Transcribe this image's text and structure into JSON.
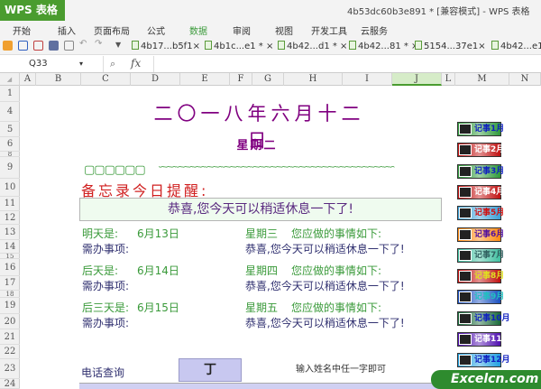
{
  "app": {
    "name": "WPS 表格",
    "window_title": "4b53dc60b3e891 * [兼容模式] - WPS 表格"
  },
  "menu": [
    "开始",
    "插入",
    "页面布局",
    "公式",
    "数据",
    "审阅",
    "视图",
    "开发工具",
    "云服务"
  ],
  "active_menu": "数据",
  "doc_tabs": [
    "4b17...b5f1×",
    "4b1c...e1 * ×",
    "4b42...d1 * ×",
    "4b42...81 * ×",
    "5154...37e1×",
    "4b42...e1"
  ],
  "formula_bar": {
    "name_box": "Q33",
    "fx": "fx",
    "value": ""
  },
  "columns": [
    "A",
    "B",
    "C",
    "D",
    "E",
    "F",
    "G",
    "H",
    "I",
    "J",
    "L",
    "M",
    "N"
  ],
  "rows": [
    "1",
    "4",
    "5",
    "6",
    "8",
    "9",
    "10",
    "11",
    "12",
    "13",
    "14",
    "15",
    "16",
    "17",
    "18",
    "19",
    "20",
    "21",
    "22",
    "23",
    "24"
  ],
  "sheet": {
    "date": "二〇一八年六月十二日",
    "weekday": "星期二",
    "deco_boxes": "▢▢▢▢▢▢",
    "deco_wave": "∽∽∽∽∽∽∽∽∽∽∽∽∽∽∽∽∽∽∽∽∽∽∽∽∽∽∽∽∽∽∽∽∽∽∽∽∽∽∽∽∽",
    "memo_title": "备忘录今日提醒:",
    "memo_text": "恭喜,您今天可以稍适休息一下了!",
    "days": [
      {
        "label": "明天是:",
        "date": "6月13日",
        "weekday": "星期三",
        "todo_head": "您应做的事情如下:",
        "todo_label": "需办事项:",
        "todo": "恭喜,您今天可以稍适休息一下了!"
      },
      {
        "label": "后天是:",
        "date": "6月14日",
        "weekday": "星期四",
        "todo_head": "您应做的事情如下:",
        "todo_label": "需办事项:",
        "todo": "恭喜,您今天可以稍适休息一下了!"
      },
      {
        "label": "后三天是:",
        "date": "6月15日",
        "weekday": "星期五",
        "todo_head": "您应做的事情如下:",
        "todo_label": "需办事项:",
        "todo": "恭喜,您今天可以稍适休息一下了!"
      }
    ],
    "phone_label": "电话查询",
    "phone_input": "丁",
    "phone_hint": "输入姓名中任一字即可"
  },
  "month_buttons": [
    {
      "label": "记事1月",
      "bg": "#2f9a3a",
      "fg": "#1020c0"
    },
    {
      "label": "记事2月",
      "bg": "#c01010",
      "fg": "#ffffff"
    },
    {
      "label": "记事3月",
      "bg": "#2f9a3a",
      "fg": "#1020c0"
    },
    {
      "label": "记事4月",
      "bg": "#c01010",
      "fg": "#ffffff"
    },
    {
      "label": "记事5月",
      "bg": "#3aa0d8",
      "fg": "#d01010"
    },
    {
      "label": "记事6月",
      "bg": "#ff8a10",
      "fg": "#5010a0"
    },
    {
      "label": "记事7月",
      "bg": "#40c0a0",
      "fg": "#306060"
    },
    {
      "label": "记事8月",
      "bg": "#c01010",
      "fg": "#e0e020"
    },
    {
      "label": "记事9月",
      "bg": "#1a50c0",
      "fg": "#20c0c0"
    },
    {
      "label": "记事10月",
      "bg": "#1a6a3a",
      "fg": "#1020c0"
    },
    {
      "label": "记事11月",
      "bg": "#5010b0",
      "fg": "#ffffff"
    },
    {
      "label": "记事12月",
      "bg": "#20a0e0",
      "fg": "#1020c0"
    }
  ],
  "watermark": "Excelcn.com"
}
